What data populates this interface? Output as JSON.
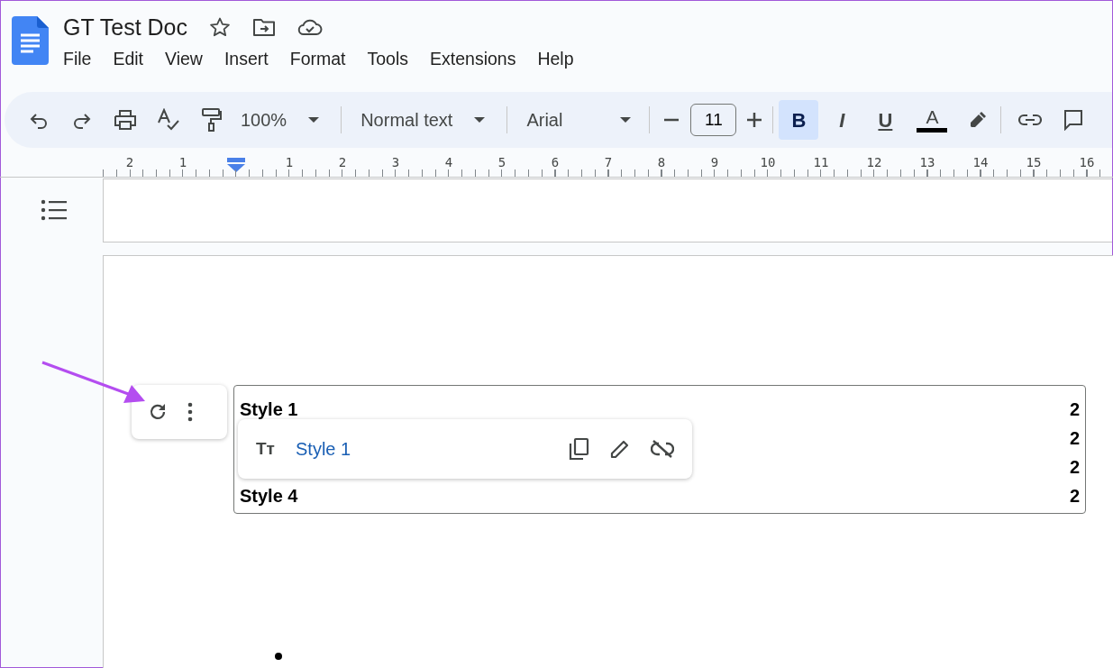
{
  "document": {
    "title": "GT Test Doc"
  },
  "menu": [
    "File",
    "Edit",
    "View",
    "Insert",
    "Format",
    "Tools",
    "Extensions",
    "Help"
  ],
  "toolbar": {
    "zoom": "100%",
    "paragraph_style": "Normal text",
    "font": "Arial",
    "font_size": "11",
    "format_buttons": [
      {
        "label": "B",
        "selected": true
      },
      {
        "label": "I",
        "selected": false
      },
      {
        "label": "U",
        "selected": false
      }
    ],
    "text_color_label": "A"
  },
  "ruler": {
    "left_labels": [
      "2",
      "1"
    ],
    "right_labels": [
      "1",
      "2",
      "3",
      "4",
      "5",
      "6",
      "7",
      "8",
      "9",
      "10",
      "11",
      "12",
      "13",
      "14",
      "15",
      "16"
    ]
  },
  "table_of_contents": [
    {
      "title": "Style 1",
      "page": "2"
    },
    {
      "page": "2"
    },
    {
      "page": "2"
    },
    {
      "title": "Style 4",
      "page": "2"
    }
  ],
  "link_popup": {
    "icon_text": "Tт",
    "link": "Style 1"
  }
}
